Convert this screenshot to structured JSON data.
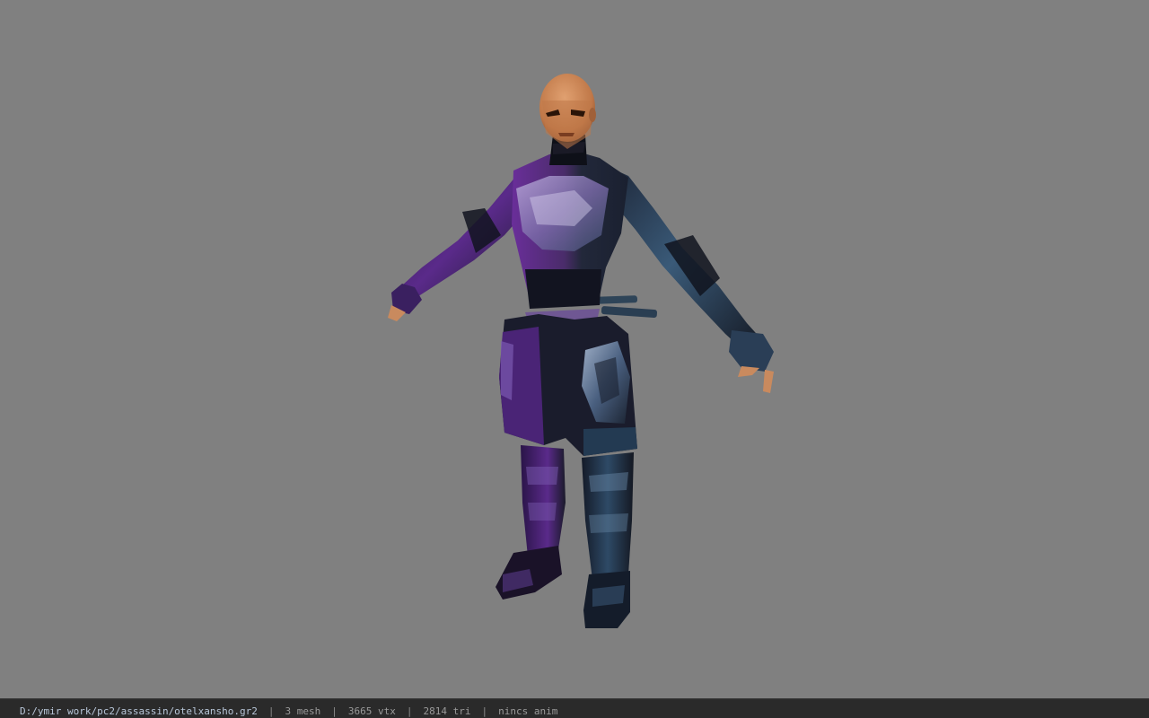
{
  "viewport": {
    "background_color": "#808080",
    "model": {
      "subject": "assassin-character",
      "colors": {
        "skin": "#c98a5e",
        "armor_dark": "#1a1c2a",
        "armor_purple": "#5a2a8a",
        "armor_steel": "#3a5a78"
      }
    }
  },
  "status_bar": {
    "file_path": "D:/ymir work/pc2/assassin/otelxansho.gr2",
    "separator": "|",
    "mesh_count": "3 mesh",
    "vertex_count": "3665 vtx",
    "triangle_count": "2814 tri",
    "animation": "nincs anim"
  }
}
